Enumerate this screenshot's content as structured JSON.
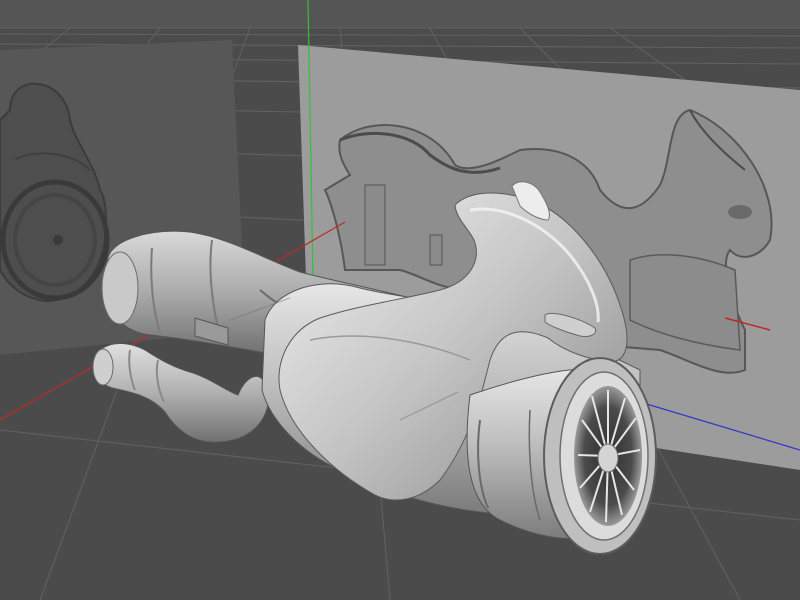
{
  "viewport": {
    "background_color": "#4b4b4b",
    "grid_color": "#626262",
    "horizon_color": "#5a5a5a"
  },
  "axes": {
    "x_color": "#c02828",
    "y_color": "#35c035",
    "z_color": "#3535c8"
  },
  "reference_images": {
    "left_plane": "front-view-blueprint",
    "right_plane": "side-view-blueprint",
    "left_plane_color": "#575757",
    "right_plane_color": "#9c9c9c"
  },
  "model": {
    "name": "jet-bike-mesh",
    "shading": "gray-smooth",
    "base_color": "#b5b5b5",
    "highlight_color": "#eeeeee",
    "shadow_color": "#6e6e6e"
  }
}
